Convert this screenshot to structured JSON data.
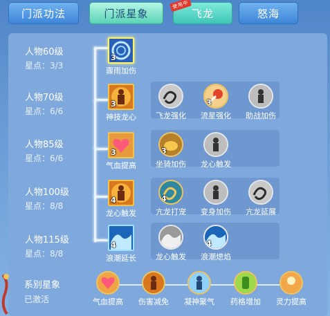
{
  "tabs": [
    {
      "label": "门派功法",
      "state": "inactive"
    },
    {
      "label": "门派星象",
      "state": "active"
    },
    {
      "label": "飞龙",
      "state": "special",
      "badge": "使用中"
    },
    {
      "label": "怒海",
      "state": "inactive"
    }
  ],
  "rows": [
    {
      "level": "人物60级",
      "points": "星点：3/3",
      "skills": [
        {
          "label": "骤雨加伤",
          "count": "3",
          "icon": "vortex-icon",
          "shape": "square",
          "selected": true
        }
      ]
    },
    {
      "level": "人物70级",
      "points": "星点：6/6",
      "skills": [
        {
          "label": "神技龙心",
          "count": "3",
          "icon": "flaming-figure-icon",
          "shape": "square"
        },
        {
          "label": "飞龙强化",
          "count": "",
          "icon": "dragon-icon",
          "shape": "circle"
        },
        {
          "label": "流星强化",
          "count": "3",
          "icon": "meteor-icon",
          "shape": "circle"
        },
        {
          "label": "助战加伤",
          "count": "",
          "icon": "figure-burst-icon",
          "shape": "circle"
        }
      ]
    },
    {
      "level": "人物85级",
      "points": "星点：6/6",
      "skills": [
        {
          "label": "气血提高",
          "count": "3",
          "icon": "heart-icon",
          "shape": "square"
        },
        {
          "label": "坐骑加伤",
          "count": "3",
          "icon": "mount-icon",
          "shape": "circle"
        },
        {
          "label": "龙心触发",
          "count": "",
          "icon": "figure-icon",
          "shape": "circle"
        }
      ]
    },
    {
      "level": "人物100级",
      "points": "星点：8/8",
      "skills": [
        {
          "label": "龙心触发",
          "count": "4",
          "icon": "flaming-figure-icon",
          "shape": "square"
        },
        {
          "label": "亢龙打宠",
          "count": "4",
          "icon": "dragon-icon",
          "shape": "circle"
        },
        {
          "label": "变身加伤",
          "count": "",
          "icon": "figure-burst-icon",
          "shape": "circle"
        },
        {
          "label": "亢龙延展",
          "count": "",
          "icon": "dragon-icon",
          "shape": "circle"
        }
      ]
    },
    {
      "level": "人物115级",
      "points": "星点：8/8",
      "skills": [
        {
          "label": "浪潮延长",
          "count": "4",
          "icon": "wave-icon",
          "shape": "square"
        },
        {
          "label": "龙心触发",
          "count": "",
          "icon": "wave-icon",
          "shape": "circle"
        },
        {
          "label": "浪潮熄焰",
          "count": "4",
          "icon": "wave-icon",
          "shape": "circle"
        }
      ]
    }
  ],
  "series": {
    "title": "系别星象",
    "status": "已激活",
    "skills": [
      {
        "label": "气血提高",
        "icon": "heart-icon"
      },
      {
        "label": "伤害减免",
        "icon": "flaming-figure-icon"
      },
      {
        "label": "凝神聚气",
        "icon": "figure-burst-icon"
      },
      {
        "label": "药格增加",
        "icon": "potion-icon"
      },
      {
        "label": "灵力提高",
        "icon": "spirit-icon"
      }
    ]
  },
  "colors": {
    "accent": "#f3c446",
    "active_tab": "#5ad4b5",
    "panel": "#7fa9dc"
  }
}
